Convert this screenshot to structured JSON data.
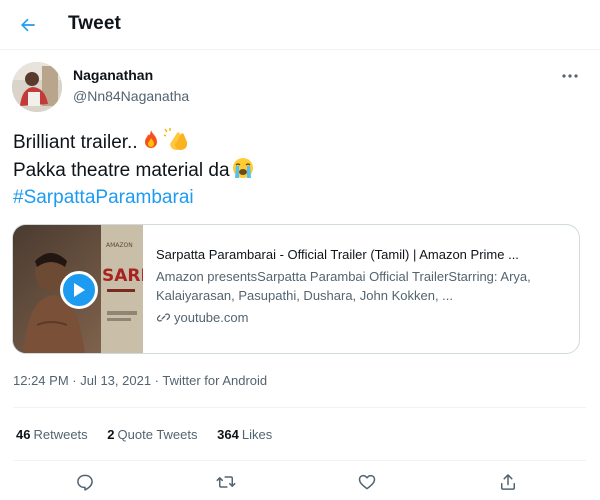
{
  "header": {
    "title": "Tweet",
    "back_icon": "arrow-left-icon",
    "accent": "#1d9bf0"
  },
  "author": {
    "name": "Naganathan",
    "handle": "@Nn84Naganatha"
  },
  "tweet": {
    "line1": "Brilliant trailer..",
    "line1_emojis": [
      "fire-emoji",
      "clapping-hands-emoji"
    ],
    "line2": "Pakka theatre material da",
    "line2_emojis": [
      "loudly-crying-face-emoji"
    ],
    "hashtag": "#SarpattaParambarai"
  },
  "card": {
    "title": "Sarpatta Parambarai - Official Trailer (Tamil) | Amazon Prime ...",
    "description": "Amazon presentsSarpatta Parambai Official TrailerStarring: Arya, Kalaiyarasan, Pasupathi, Dushara, John Kokken, ...",
    "domain": "youtube.com",
    "thumbnail_brand": "AMAZON",
    "thumbnail_title": "SARPA"
  },
  "meta": {
    "time": "12:24 PM",
    "date": "Jul 13, 2021",
    "source": "Twitter for Android"
  },
  "stats": {
    "retweets_count": "46",
    "retweets_label": "Retweets",
    "quotes_count": "2",
    "quotes_label": "Quote Tweets",
    "likes_count": "364",
    "likes_label": "Likes"
  },
  "actions": [
    "reply-icon",
    "retweet-icon",
    "like-icon",
    "share-icon"
  ],
  "colors": {
    "link": "#1d9bf0",
    "secondary_text": "#536471",
    "border": "#cfd9de"
  }
}
